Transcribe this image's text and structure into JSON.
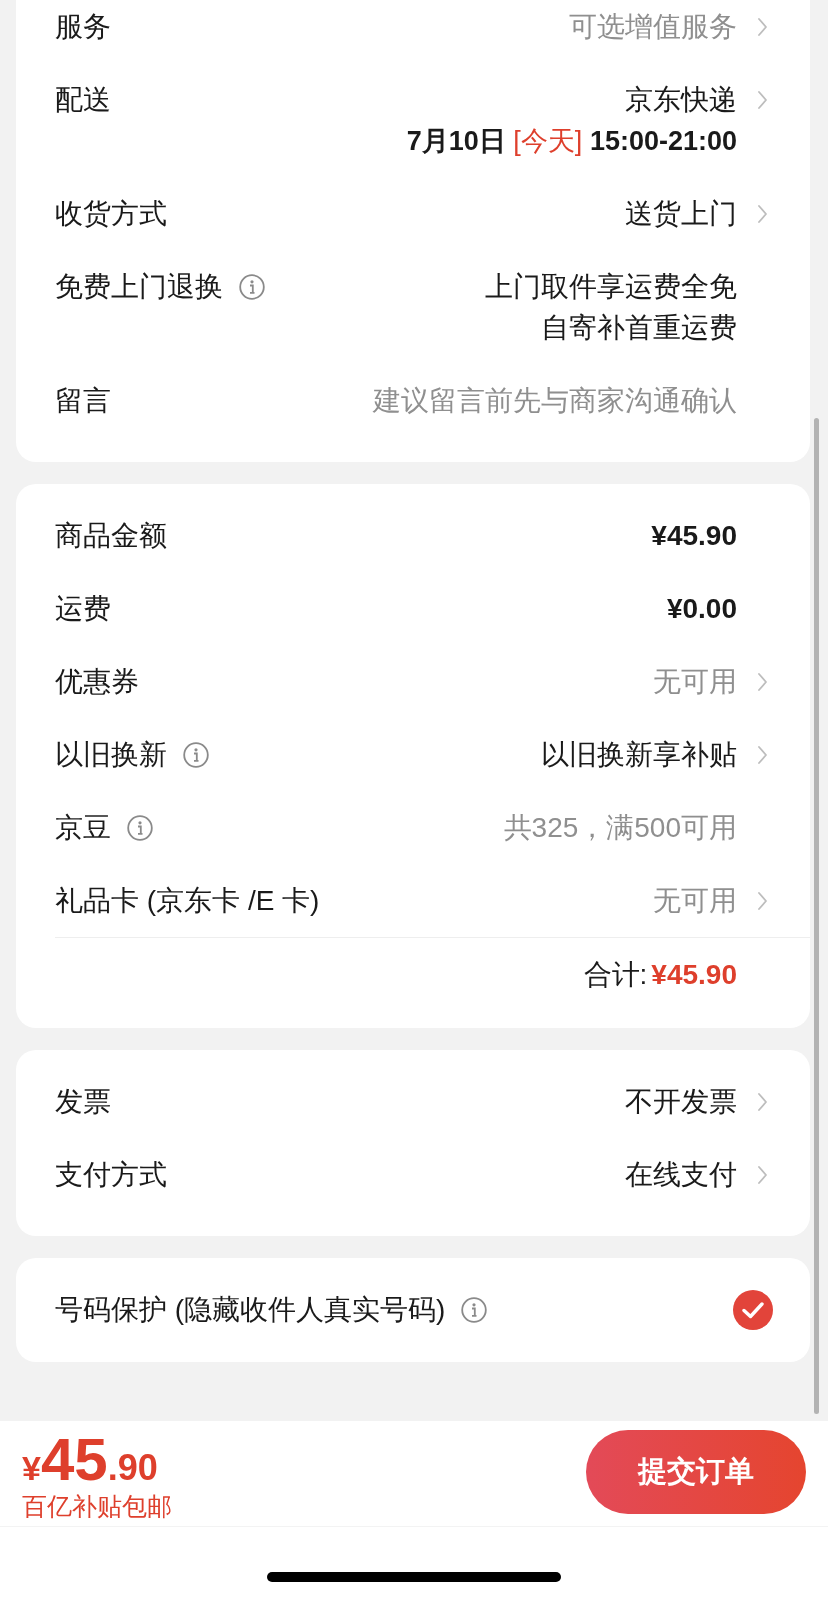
{
  "sections": [
    {
      "rows": [
        {
          "label": "服务",
          "kind": "link",
          "info": false,
          "value": "可选增值服务",
          "dimmed": true
        },
        {
          "label": "配送",
          "kind": "link",
          "info": false,
          "value": "京东快递",
          "dimmed": false,
          "schedule": {
            "date": "7月10日",
            "tag": "[今天]",
            "time": "15:00-21:00"
          }
        },
        {
          "label": "收货方式",
          "kind": "link",
          "info": false,
          "value": "送货上门",
          "dimmed": false
        },
        {
          "label": "免费上门退换",
          "kind": "text",
          "info": true,
          "value_lines": [
            "上门取件享运费全免",
            "自寄补首重运费"
          ],
          "dimmed": false
        },
        {
          "label": "留言",
          "kind": "input",
          "info": false,
          "placeholder": "建议留言前先与商家沟通确认"
        }
      ]
    },
    {
      "rows": [
        {
          "label": "商品金额",
          "kind": "amount",
          "info": false,
          "value": "¥45.90",
          "dimmed": false
        },
        {
          "label": "运费",
          "kind": "amount",
          "info": false,
          "value": "¥0.00",
          "dimmed": false
        },
        {
          "label": "优惠券",
          "kind": "link",
          "info": false,
          "value": "无可用",
          "dimmed": true
        },
        {
          "label": "以旧换新",
          "kind": "link",
          "info": true,
          "value": "以旧换新享补贴",
          "dimmed": false
        },
        {
          "label": "京豆",
          "kind": "text",
          "info": true,
          "value": "共325，满500可用",
          "dimmed": true
        },
        {
          "label": "礼品卡 (京东卡 /E 卡)",
          "kind": "link",
          "info": false,
          "value": "无可用",
          "dimmed": true
        }
      ],
      "total": {
        "label": "合计:",
        "amount": "¥45.90"
      }
    },
    {
      "rows": [
        {
          "label": "发票",
          "kind": "link",
          "info": false,
          "value": "不开发票",
          "dimmed": false
        },
        {
          "label": "支付方式",
          "kind": "link",
          "info": false,
          "value": "在线支付",
          "dimmed": false
        }
      ]
    }
  ],
  "privacy": {
    "label": "号码保护 (隐藏收件人真实号码)",
    "info": true,
    "checked": true
  },
  "footer": {
    "price": {
      "currency": "¥",
      "integer": "45",
      "decimal": ".90"
    },
    "note": "百亿补贴包邮",
    "submit_button": "提交订单"
  }
}
